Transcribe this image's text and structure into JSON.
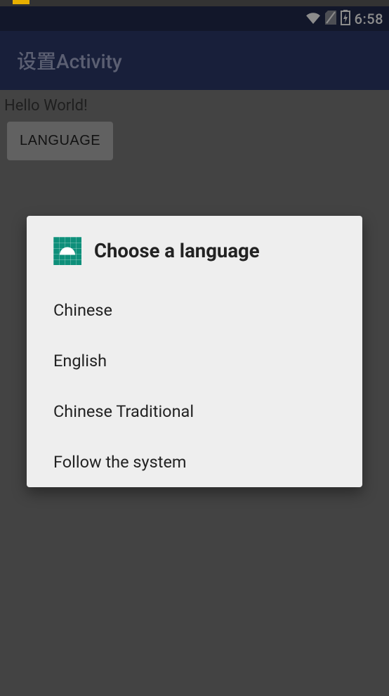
{
  "statusbar": {
    "time": "6:58"
  },
  "appbar": {
    "title": "设置Activity"
  },
  "content": {
    "greeting": "Hello World!",
    "language_button": "LANGUAGE"
  },
  "dialog": {
    "icon_name": "android-robot",
    "title": "Choose a language",
    "options": [
      {
        "label": "Chinese"
      },
      {
        "label": "English"
      },
      {
        "label": "Chinese Traditional"
      },
      {
        "label": "Follow the system"
      }
    ]
  }
}
